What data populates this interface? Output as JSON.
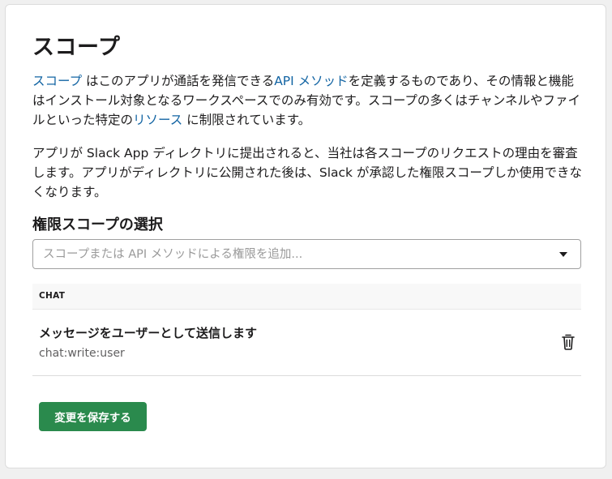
{
  "page": {
    "title": "スコープ",
    "intro": {
      "link_scopes": "スコープ",
      "text_1": " はこのアプリが通話を発信できる",
      "link_api_methods": "API メソッド",
      "text_2": "を定義するものであり、その情報と機能はインストール対象となるワークスペースでのみ有効です。スコープの多くはチャンネルやファイルといった特定の",
      "link_resources": "リソース",
      "text_3": " に制限されています。"
    },
    "review_note": "アプリが Slack App ディレクトリに提出されると、当社は各スコープのリクエストの理由を審査します。アプリがディレクトリに公開された後は、Slack が承認した権限スコープしか使用できなくなります。"
  },
  "permission_scopes": {
    "heading": "権限スコープの選択",
    "select_placeholder": "スコープまたは API メソッドによる権限を追加...",
    "select_value": "",
    "groups": [
      {
        "name": "CHAT",
        "items": [
          {
            "title": "メッセージをユーザーとして送信します",
            "scope": "chat:write:user",
            "remove_icon": "trash-icon"
          }
        ]
      }
    ]
  },
  "actions": {
    "save_label": "変更を保存する",
    "save_color": "#2a8a4d"
  },
  "colors": {
    "link": "#1264a3",
    "text": "#1d1c1d",
    "muted": "#616061"
  }
}
